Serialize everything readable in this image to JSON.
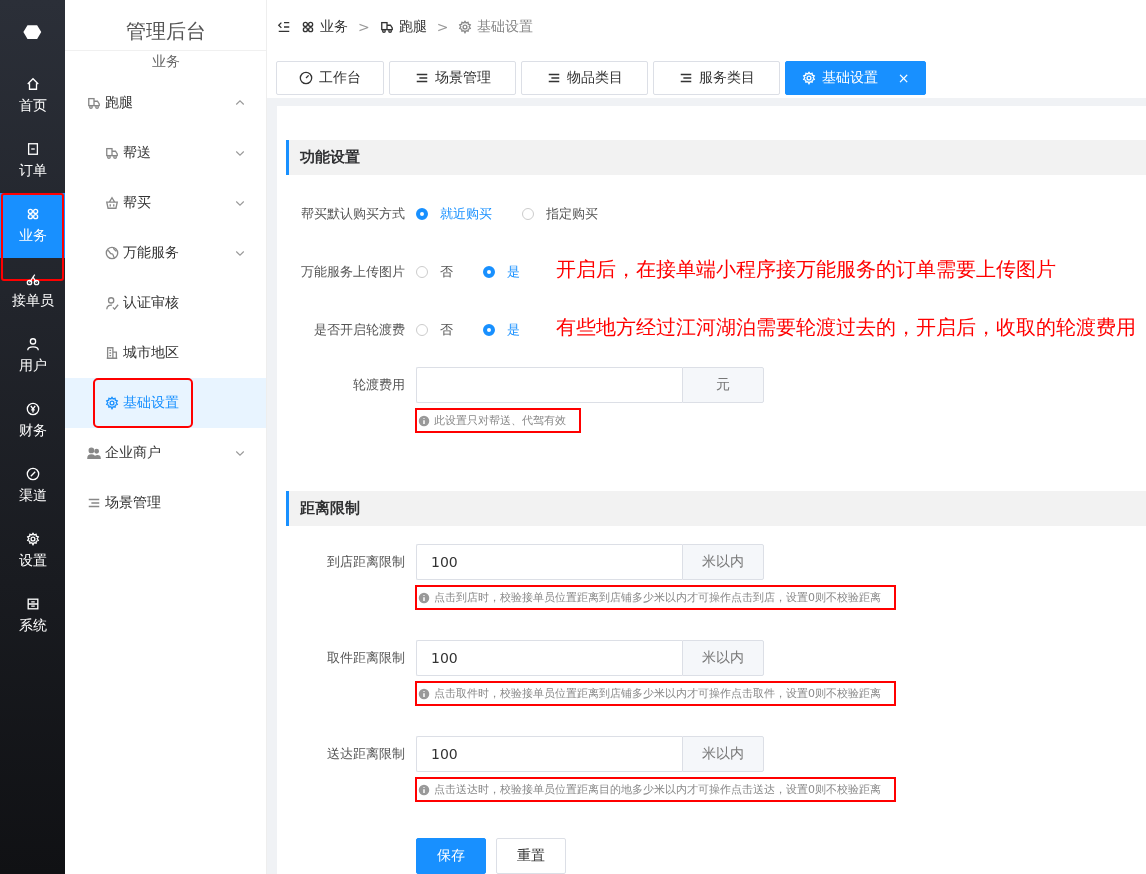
{
  "rail": {
    "items": [
      {
        "label": "首页",
        "selected": false
      },
      {
        "label": "订单",
        "selected": false
      },
      {
        "label": "业务",
        "selected": true,
        "marked": true
      },
      {
        "label": "接单员",
        "selected": false
      },
      {
        "label": "用户",
        "selected": false
      },
      {
        "label": "财务",
        "selected": false
      },
      {
        "label": "渠道",
        "selected": false
      },
      {
        "label": "设置",
        "selected": false
      },
      {
        "label": "系统",
        "selected": false
      }
    ]
  },
  "sidebar": {
    "title": "管理后台",
    "subtitle": "业务",
    "items": [
      {
        "label": "跑腿",
        "selected": false,
        "expanded": true,
        "children": [
          {
            "label": "帮送",
            "selected": false,
            "expanded": false
          },
          {
            "label": "帮买",
            "selected": false,
            "expanded": false
          },
          {
            "label": "万能服务",
            "selected": false,
            "expanded": false
          },
          {
            "label": "认证审核",
            "selected": false
          },
          {
            "label": "城市地区",
            "selected": false
          },
          {
            "label": "基础设置",
            "selected": true,
            "marked": true
          }
        ]
      },
      {
        "label": "企业商户",
        "selected": false,
        "expanded": false
      },
      {
        "label": "场景管理",
        "selected": false
      }
    ]
  },
  "breadcrumb": [
    "业务",
    "跑腿",
    "基础设置"
  ],
  "breadcrumb_separator": ">",
  "tabs": [
    {
      "label": "工作台",
      "selected": false
    },
    {
      "label": "场景管理",
      "selected": false
    },
    {
      "label": "物品类目",
      "selected": false
    },
    {
      "label": "服务类目",
      "selected": false
    },
    {
      "label": "基础设置",
      "selected": true,
      "close": "×"
    }
  ],
  "sections": [
    {
      "title": "功能设置",
      "fields": [
        {
          "kind": "radio",
          "label": "帮买默认购买方式",
          "options": [
            {
              "label": "就近购买",
              "selected": true
            },
            {
              "label": "指定购买",
              "selected": false
            }
          ]
        },
        {
          "kind": "radio",
          "label": "万能服务上传图片",
          "options": [
            {
              "label": "否",
              "selected": false
            },
            {
              "label": "是",
              "selected": true
            }
          ],
          "note": "开启后，在接单端小程序接万能服务的订单需要上传图片"
        },
        {
          "kind": "radio",
          "label": "是否开启轮渡费",
          "options": [
            {
              "label": "否",
              "selected": false
            },
            {
              "label": "是",
              "selected": true
            }
          ],
          "note": "有些地方经过江河湖泊需要轮渡过去的，开启后，收取的轮渡费用"
        },
        {
          "kind": "input",
          "label": "轮渡费用",
          "unit": "元",
          "hint": "此设置只对帮送、代驾有效",
          "marked": true
        }
      ]
    },
    {
      "title": "距离限制",
      "fields": [
        {
          "kind": "input",
          "label": "到店距离限制",
          "value": "100",
          "unit": "米以内",
          "hint": "点击到店时，校验接单员位置距离到店铺多少米以内才可操作点击到店，设置0则不校验距离",
          "marked": true
        },
        {
          "kind": "input",
          "label": "取件距离限制",
          "value": "100",
          "unit": "米以内",
          "hint": "点击取件时，校验接单员位置距离到店铺多少米以内才可操作点击取件，设置0则不校验距离",
          "marked": true
        },
        {
          "kind": "input",
          "label": "送达距离限制",
          "value": "100",
          "unit": "米以内",
          "hint": "点击送达时，校验接单员位置距离目的地多少米以内才可操作点击送达，设置0则不校验距离",
          "marked": true
        }
      ]
    }
  ],
  "buttons": [
    {
      "label": "保存",
      "kind": "primary"
    },
    {
      "label": "重置",
      "kind": "default"
    }
  ]
}
